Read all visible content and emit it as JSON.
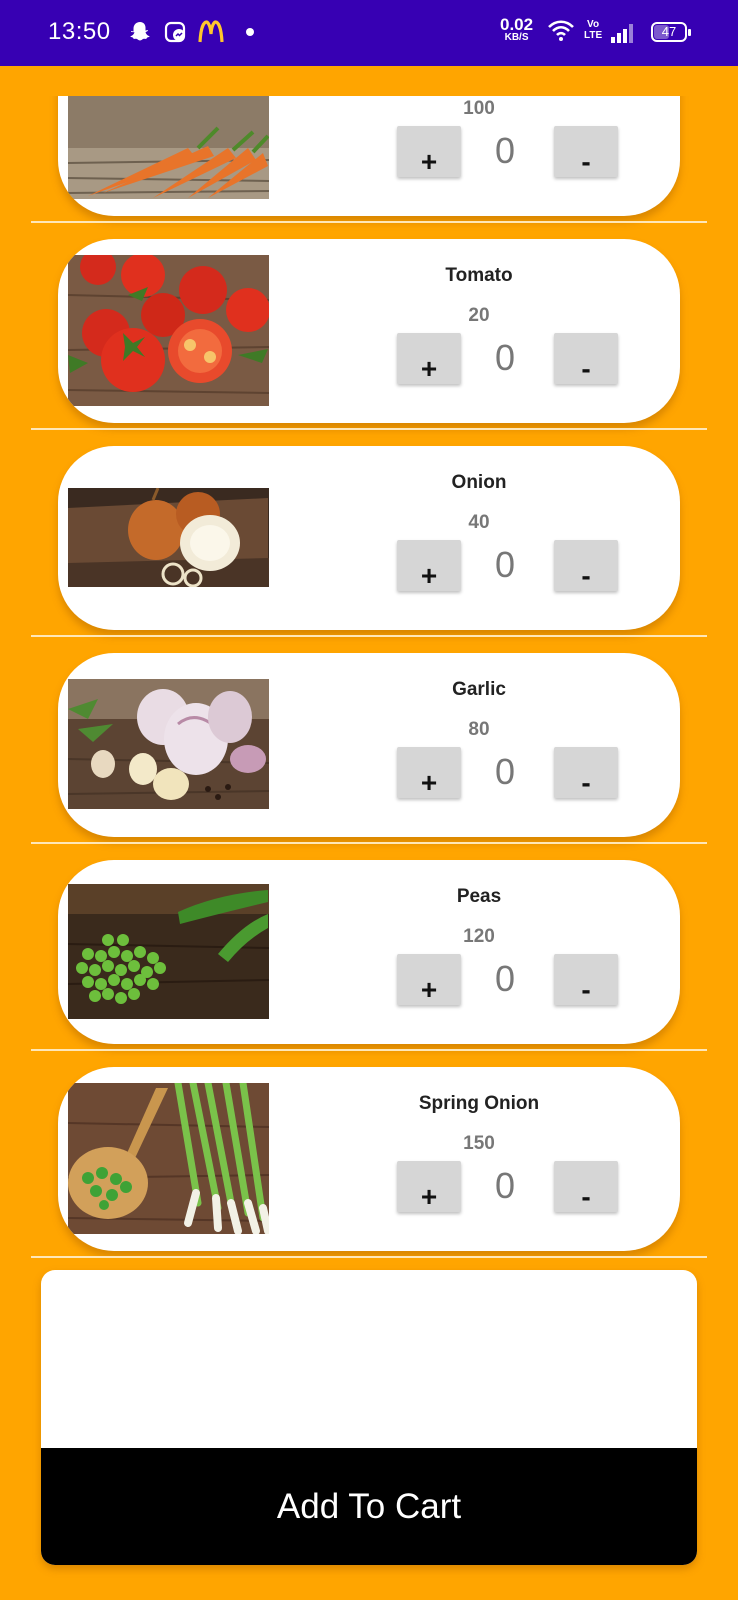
{
  "status_bar": {
    "time": "13:50",
    "net_speed": "0.02",
    "net_unit": "KB/S",
    "volte_top": "Vo",
    "volte_bottom": "LTE",
    "battery": "47",
    "icons": [
      "snapchat-icon",
      "messenger-icon",
      "mcdonalds-icon",
      "dot-icon",
      "wifi-icon",
      "signal-icon",
      "battery-icon"
    ]
  },
  "items": [
    {
      "name": "",
      "price": "100",
      "qty": "0",
      "plus": "+",
      "minus": "-",
      "image": "carrot-image"
    },
    {
      "name": "Tomato",
      "price": "20",
      "qty": "0",
      "plus": "+",
      "minus": "-",
      "image": "tomato-image"
    },
    {
      "name": "Onion",
      "price": "40",
      "qty": "0",
      "plus": "+",
      "minus": "-",
      "image": "onion-image"
    },
    {
      "name": "Garlic",
      "price": "80",
      "qty": "0",
      "plus": "+",
      "minus": "-",
      "image": "garlic-image"
    },
    {
      "name": "Peas",
      "price": "120",
      "qty": "0",
      "plus": "+",
      "minus": "-",
      "image": "peas-image"
    },
    {
      "name": "Spring Onion",
      "price": "150",
      "qty": "0",
      "plus": "+",
      "minus": "-",
      "image": "spring-onion-image"
    }
  ],
  "cart": {
    "button_label": "Add To Cart"
  },
  "colors": {
    "background": "#FFA500",
    "status_bar": "#3700B3",
    "card": "#FFFFFF",
    "button": "#D6D6D6",
    "cart_button": "#000000"
  }
}
